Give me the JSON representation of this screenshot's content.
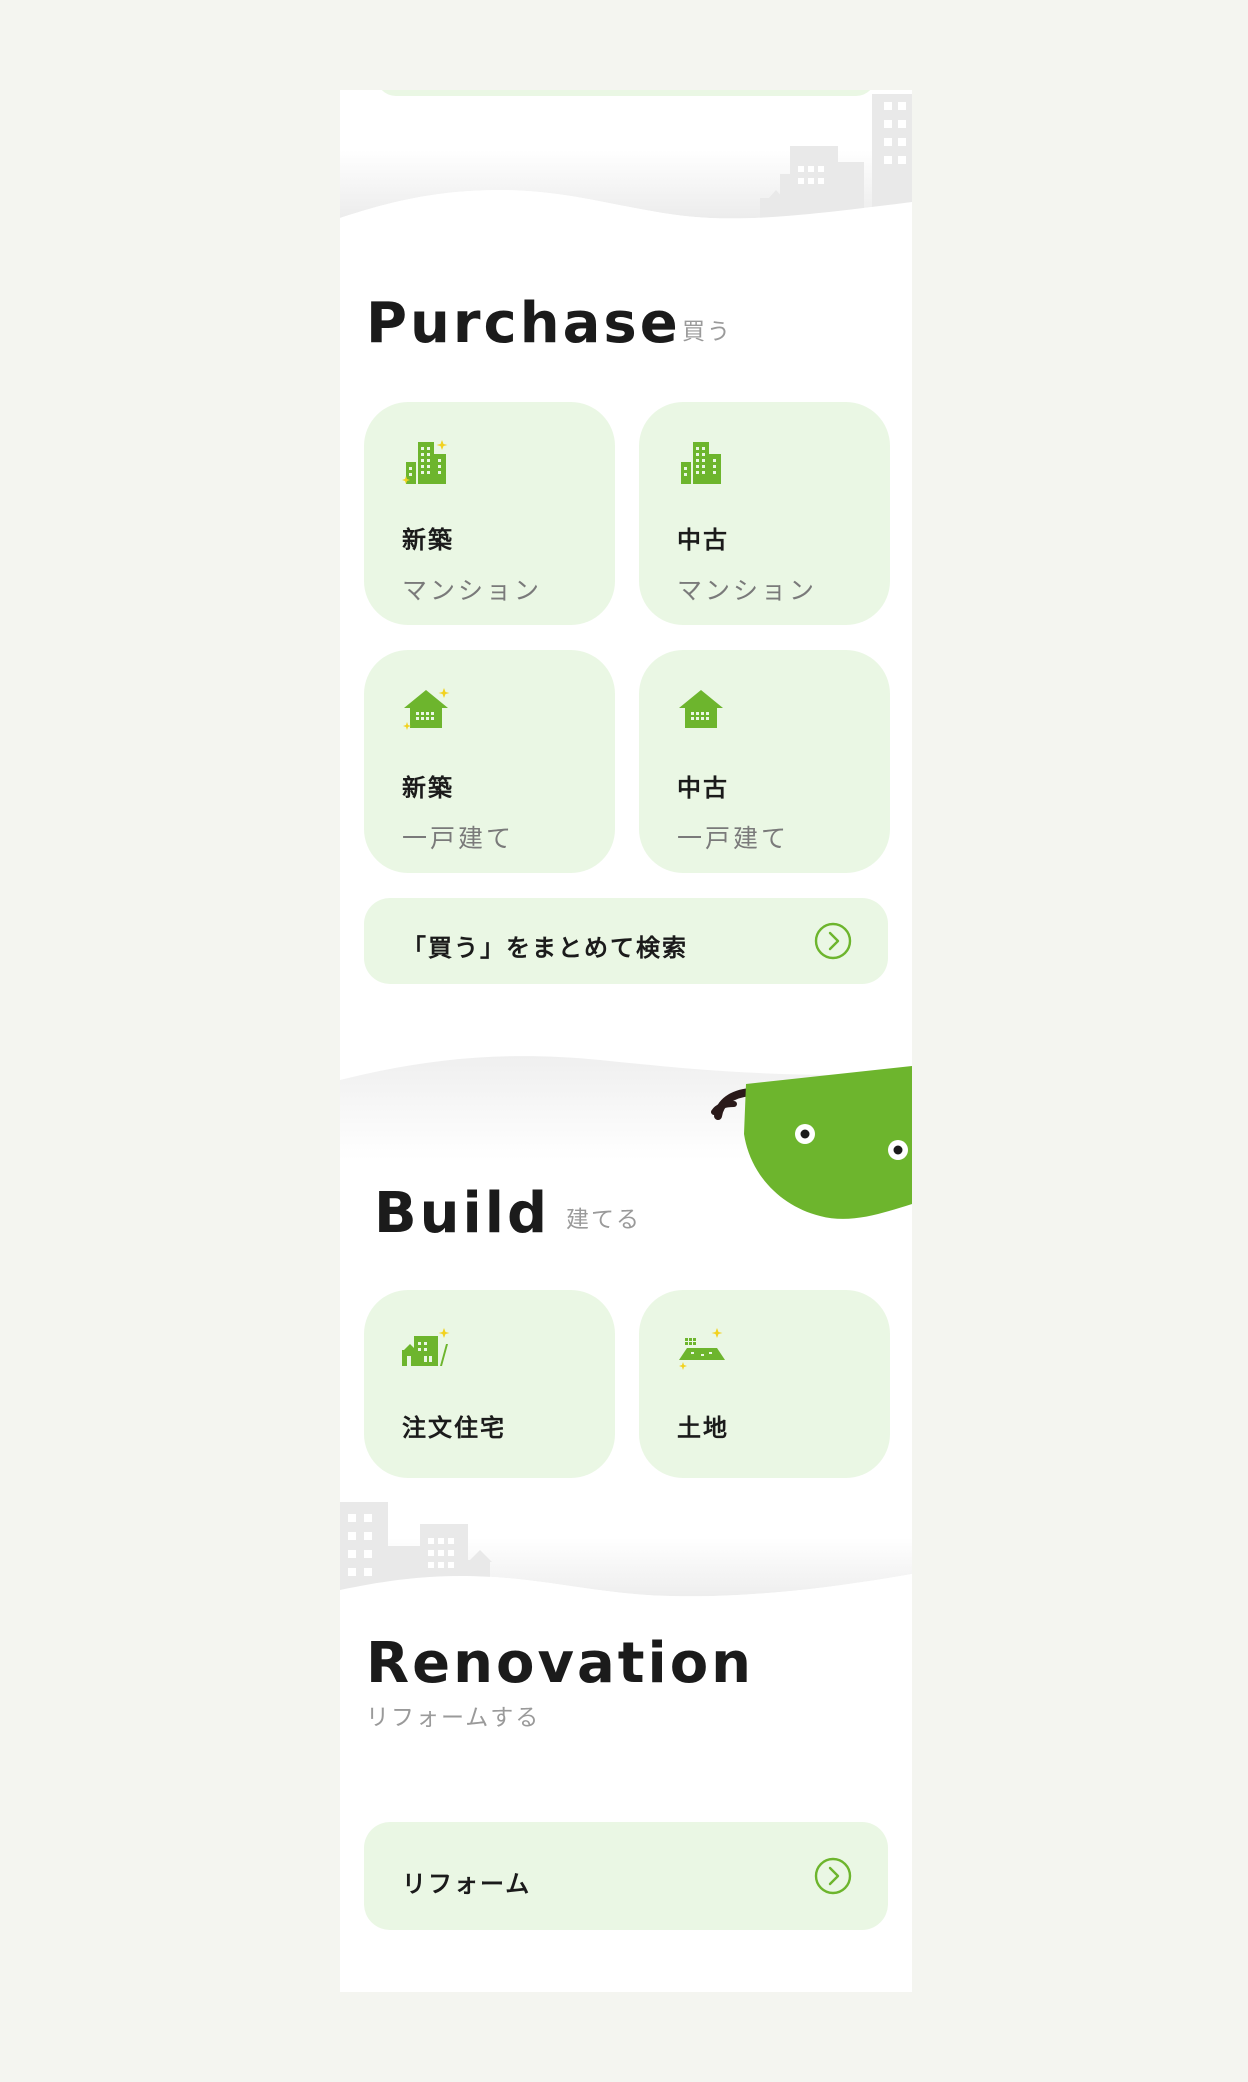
{
  "colors": {
    "accent": "#6db52d",
    "card_bg": "#eaf7e4",
    "page_bg": "#f4f5f0",
    "sparkle": "#f2d21f",
    "mascot": "#6db52d"
  },
  "purchase": {
    "title": "Purchase",
    "sub": "買う",
    "cards": [
      {
        "line1": "新築",
        "line2": "マンション",
        "icon": "new-apartment-icon"
      },
      {
        "line1": "中古",
        "line2": "マンション",
        "icon": "used-apartment-icon"
      },
      {
        "line1": "新築",
        "line2": "一戸建て",
        "icon": "new-house-icon"
      },
      {
        "line1": "中古",
        "line2": "一戸建て",
        "icon": "used-house-icon"
      }
    ],
    "search_all": "「買う」をまとめて検索",
    "search_icon": "chevron-right-circle-icon"
  },
  "build": {
    "title": "Build",
    "sub": "建てる",
    "cards": [
      {
        "line1": "注文住宅",
        "icon": "custom-house-icon"
      },
      {
        "line1": "土地",
        "icon": "land-icon"
      }
    ]
  },
  "renovation": {
    "title": "Renovation",
    "sub": "リフォームする",
    "button": "リフォーム",
    "button_icon": "chevron-right-circle-icon"
  }
}
